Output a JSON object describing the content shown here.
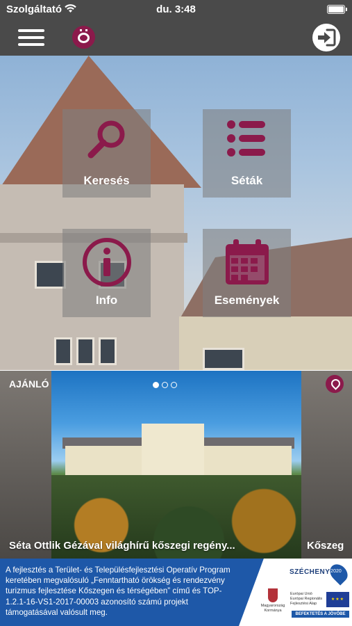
{
  "status_bar": {
    "carrier": "Szolgáltató",
    "time": "du. 3:48"
  },
  "nav": {
    "menu_icon": "hamburger-menu-icon",
    "logo_icon": "city-crest-icon",
    "login_icon": "login-icon"
  },
  "tiles": [
    {
      "label": "Keresés",
      "icon": "search-icon"
    },
    {
      "label": "Séták",
      "icon": "list-icon"
    },
    {
      "label": "Info",
      "icon": "info-icon"
    },
    {
      "label": "Események",
      "icon": "calendar-icon"
    }
  ],
  "carousel": {
    "left_label": "AJÁNLÓ",
    "main_title": "Séta Ottlik Gézával világhírű kőszegi regény...",
    "right_label": "Kőszeg",
    "page_count": 3,
    "active_page": 1
  },
  "footer": {
    "text": "A fejlesztés a Terület- és Településfejlesztési Operatív Program keretében megvalósuló „Fenntartható örökség és rendezvény turizmus fejlesztése Kőszegen és térségében” című és TOP-1.2.1-16-VS1-2017-00003 azonosító számú projekt támogatásával valósult meg.",
    "szechenyi": "SZÉCHENYI",
    "pin_label": "2020",
    "gov_label": "Magyarország Kormánya",
    "eu_text": "Európai Unió Európai Regionális Fejlesztési Alap",
    "eu_banner": "BEFEKTETÉS A JÖVŐBE"
  },
  "colors": {
    "accent": "#8b1a4b",
    "bar": "#4a4a4a",
    "footer_blue": "#1e58a8"
  }
}
